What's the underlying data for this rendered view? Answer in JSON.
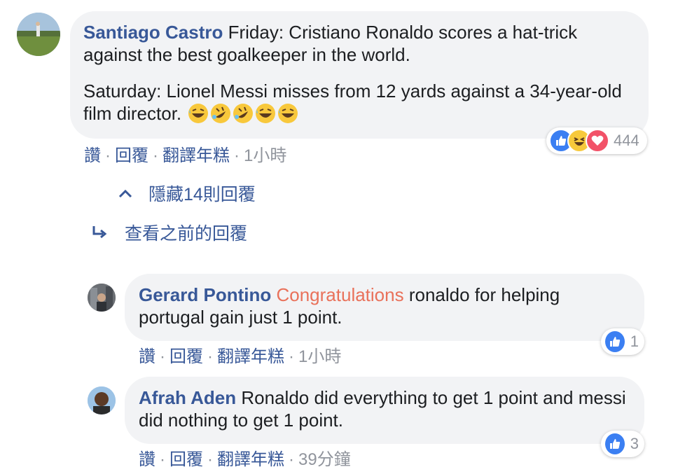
{
  "comment": {
    "author": "Santiago Castro",
    "line1": "Friday: Cristiano Ronaldo scores a hat-trick against the best goalkeeper in the world.",
    "line2": "Saturday: Lionel Messi misses from 12 yards against a 34-year-old film director.",
    "emojis": [
      "grinning-sweat",
      "rofl",
      "rofl",
      "grinning-sweat",
      "grinning-sweat"
    ],
    "reaction_count": "444",
    "reactions": [
      "like",
      "haha",
      "love"
    ],
    "actions": {
      "like": "讚",
      "reply": "回覆",
      "translate": "翻譯年糕",
      "time": "1小時"
    }
  },
  "hide_replies": "隱藏14則回覆",
  "view_previous": "查看之前的回覆",
  "replies": [
    {
      "author": "Gerard Pontino",
      "mention": "Congratulations",
      "text": "ronaldo for helping portugal gain just 1 point.",
      "reaction_count": "1",
      "actions": {
        "like": "讚",
        "reply": "回覆",
        "translate": "翻譯年糕",
        "time": "1小時"
      }
    },
    {
      "author": "Afrah Aden",
      "text": "Ronaldo did everything to get 1 point and messi did nothing to get 1 point.",
      "reaction_count": "3",
      "actions": {
        "like": "讚",
        "reply": "回覆",
        "translate": "翻譯年糕",
        "time": "39分鐘"
      }
    }
  ],
  "colors": {
    "link": "#385898",
    "mention": "#e9715a",
    "bubble": "#f2f3f5",
    "meta": "#90949c",
    "like": "#3b7ff2"
  }
}
